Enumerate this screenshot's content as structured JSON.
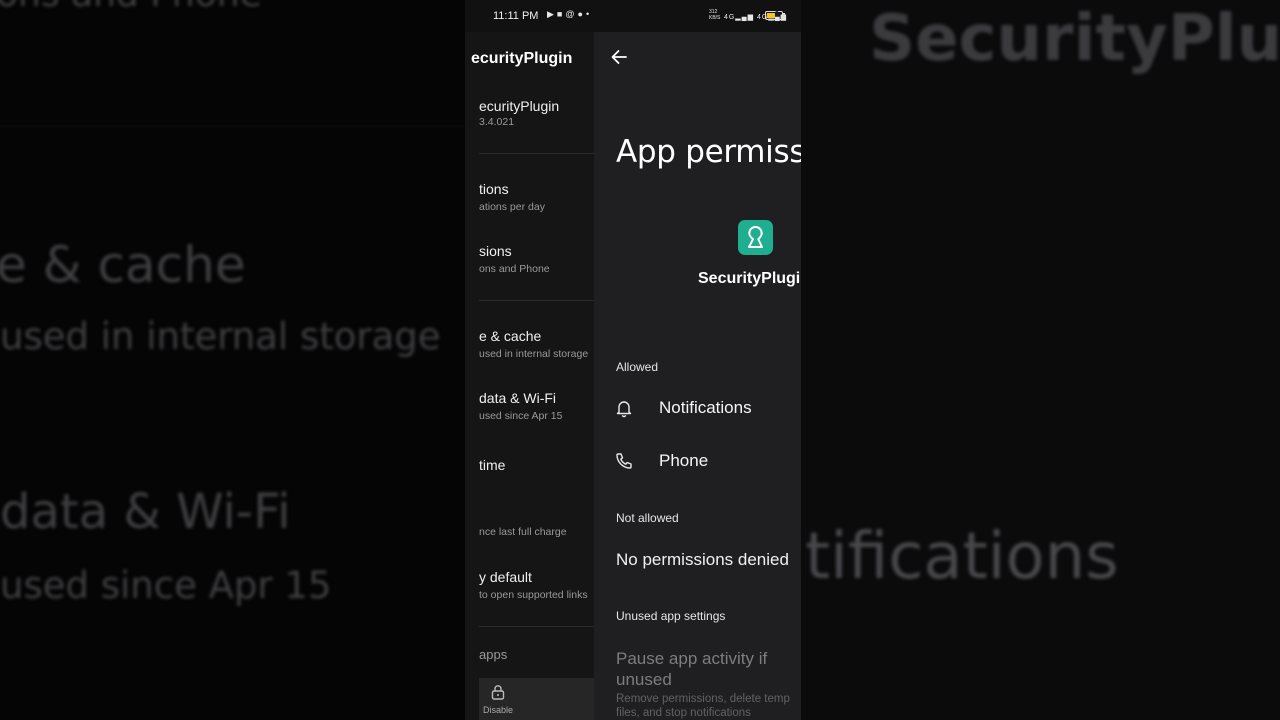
{
  "background": {
    "left_lines": [
      "ons and Phone",
      "e & cache",
      "used in internal storage",
      "data & Wi-Fi",
      "used since Apr 15"
    ],
    "right_lines": [
      "SecurityPlugi",
      "tifications"
    ]
  },
  "status_bar": {
    "time": "11:11 PM",
    "left_icons": [
      "youtube-icon",
      "video-icon",
      "threads-icon",
      "chat-icon",
      "dot-icon"
    ],
    "right_icons": [
      "data-speed",
      "signal-4g",
      "signal-4g",
      "battery-icon"
    ],
    "data_speed": "312 KB/S",
    "battery_level": "3",
    "battery_color": "#f3c623"
  },
  "app_info": {
    "title": "ecurityPlugin",
    "app_name": "ecurityPlugin",
    "version": "3.4.021",
    "items": [
      {
        "title": "tions",
        "sub": "ations per day"
      },
      {
        "title": "sions",
        "sub": "ons and Phone"
      },
      {
        "title": "e & cache",
        "sub": "used in internal storage"
      },
      {
        "title": "data & Wi-Fi",
        "sub": "used since Apr 15"
      },
      {
        "title": "time",
        "sub": ""
      },
      {
        "title": "",
        "sub": "nce last full charge"
      },
      {
        "title": "y default",
        "sub": "to open supported links"
      },
      {
        "title": "apps",
        "sub": ""
      }
    ],
    "disable_label": "Disable"
  },
  "permissions": {
    "title": "App permissi",
    "app_name": "SecurityPlugi",
    "app_icon_color": "#1fae8f",
    "allowed_label": "Allowed",
    "allowed": [
      {
        "label": "Notifications",
        "icon": "bell-icon"
      },
      {
        "label": "Phone",
        "icon": "phone-icon"
      }
    ],
    "not_allowed_label": "Not allowed",
    "no_denied_text": "No permissions denied",
    "unused_label": "Unused app settings",
    "pause_title": "Pause app activity if unused",
    "pause_sub": "Remove permissions, delete temp files, and stop notifications"
  }
}
